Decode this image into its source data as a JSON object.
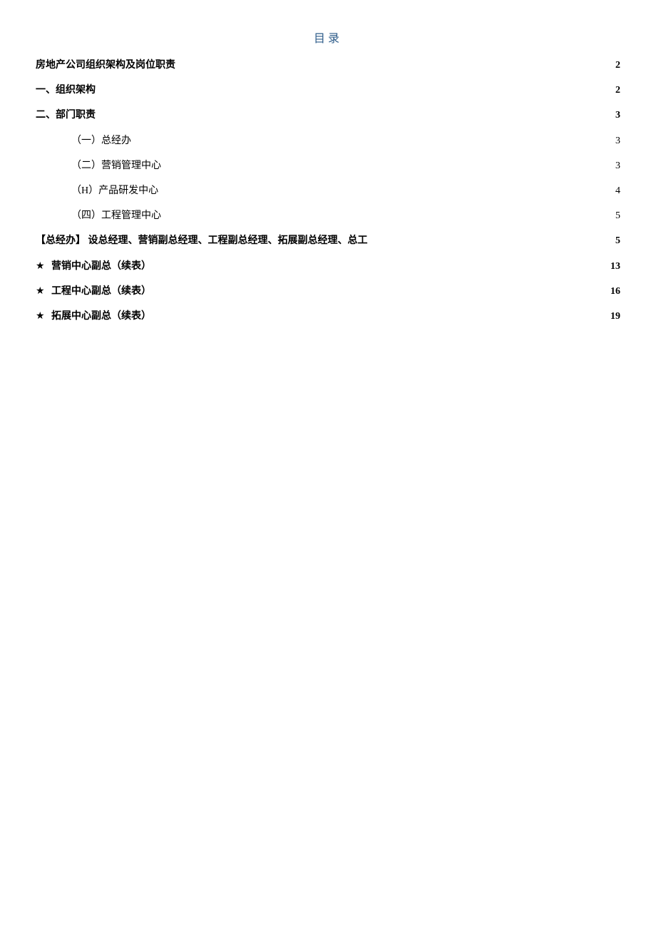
{
  "title": "目录",
  "entries": [
    {
      "label": "房地产公司组织架构及岗位职责",
      "page": "2",
      "bold": true,
      "indent": false,
      "star": false
    },
    {
      "label": "一、组织架构",
      "page": "2",
      "bold": true,
      "indent": false,
      "star": false
    },
    {
      "label": "二、部门职责",
      "page": "3",
      "bold": true,
      "indent": false,
      "star": false
    },
    {
      "label": "（一）总经办",
      "page": "3",
      "bold": false,
      "indent": true,
      "star": false
    },
    {
      "label": "（二）营销管理中心",
      "page": "3",
      "bold": false,
      "indent": true,
      "star": false
    },
    {
      "label": "（H）产品研发中心",
      "page": "4",
      "bold": false,
      "indent": true,
      "star": false
    },
    {
      "label": "（四）工程管理中心",
      "page": "5",
      "bold": false,
      "indent": true,
      "star": false
    },
    {
      "label": "【总经办】 设总经理、营销副总经理、工程副总经理、拓展副总经理、总工",
      "page": "5",
      "bold": true,
      "indent": false,
      "star": false
    },
    {
      "label": "营销中心副总（续表）",
      "page": "13",
      "bold": true,
      "indent": false,
      "star": true
    },
    {
      "label": "工程中心副总（续表）",
      "page": "16",
      "bold": true,
      "indent": false,
      "star": true
    },
    {
      "label": "拓展中心副总（续表）",
      "page": "19",
      "bold": true,
      "indent": false,
      "star": true
    }
  ]
}
